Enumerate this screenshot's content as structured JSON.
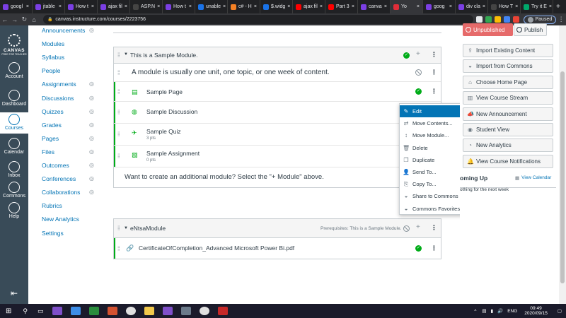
{
  "browser": {
    "tabs": [
      {
        "label": "googl",
        "color": "#7b3fe4"
      },
      {
        "label": "jtable",
        "color": "#7b3fe4"
      },
      {
        "label": "How t",
        "color": "#7b3fe4"
      },
      {
        "label": "ajax fil",
        "color": "#7b3fe4"
      },
      {
        "label": "ASP.N",
        "color": "#444444"
      },
      {
        "label": "How t",
        "color": "#7b3fe4"
      },
      {
        "label": "unable",
        "color": "#1a73e8"
      },
      {
        "label": "c# - H",
        "color": "#f48024"
      },
      {
        "label": "$.widg",
        "color": "#1a73e8"
      },
      {
        "label": "ajax fil",
        "color": "#ff0000"
      },
      {
        "label": "Part 3",
        "color": "#ff0000"
      },
      {
        "label": "canva",
        "color": "#7b3fe4"
      },
      {
        "label": "Yo",
        "color": "#e12d39",
        "active": true
      },
      {
        "label": "goog",
        "color": "#7b3fe4"
      },
      {
        "label": "div cla",
        "color": "#7b3fe4"
      },
      {
        "label": "How T",
        "color": "#444444"
      },
      {
        "label": "Try it E",
        "color": "#00a86b"
      }
    ],
    "url": "canvas.instructure.com/courses/2223756",
    "profile_status": "Paused"
  },
  "global_nav": {
    "logo": "CANVAS",
    "logo_sub": "FREE FOR TEACHER",
    "items": [
      {
        "label": "Account",
        "icon": "account-icon"
      },
      {
        "label": "Dashboard",
        "icon": "dashboard-icon"
      },
      {
        "label": "Courses",
        "icon": "courses-icon",
        "active": true
      },
      {
        "label": "Calendar",
        "icon": "calendar-icon"
      },
      {
        "label": "Inbox",
        "icon": "inbox-icon"
      },
      {
        "label": "Commons",
        "icon": "commons-icon"
      },
      {
        "label": "Help",
        "icon": "help-icon"
      }
    ]
  },
  "course_nav": {
    "items": [
      {
        "label": "Announcements",
        "hidden": true
      },
      {
        "label": "Modules",
        "hidden": false
      },
      {
        "label": "Syllabus",
        "hidden": false
      },
      {
        "label": "People",
        "hidden": false
      },
      {
        "label": "Assignments",
        "hidden": true
      },
      {
        "label": "Discussions",
        "hidden": true
      },
      {
        "label": "Quizzes",
        "hidden": true
      },
      {
        "label": "Grades",
        "hidden": true
      },
      {
        "label": "Pages",
        "hidden": true
      },
      {
        "label": "Files",
        "hidden": true
      },
      {
        "label": "Outcomes",
        "hidden": true
      },
      {
        "label": "Conferences",
        "hidden": true
      },
      {
        "label": "Collaborations",
        "hidden": true
      },
      {
        "label": "Rubrics",
        "hidden": false
      },
      {
        "label": "New Analytics",
        "hidden": false
      },
      {
        "label": "Settings",
        "hidden": false
      }
    ]
  },
  "modules": [
    {
      "title": "This is a Sample Module.",
      "description": "A module is usually one unit, one topic, or one week of content.",
      "items": [
        {
          "title": "Sample Page",
          "sub": "",
          "icon": "page-icon"
        },
        {
          "title": "Sample Discussion",
          "sub": "",
          "icon": "discussion-icon"
        },
        {
          "title": "Sample Quiz",
          "sub": "3 pts",
          "icon": "quiz-icon"
        },
        {
          "title": "Sample Assignment",
          "sub": "0 pts",
          "icon": "assignment-icon"
        }
      ],
      "footer": "Want to create an additional module? Select the \"+ Module\" above."
    },
    {
      "title": "eNtsaModule",
      "prerequisites": "Prerequisites: This is a Sample Module.",
      "items": [
        {
          "title": "CertificateOfCompletion_Advanced Microsoft Power Bi.pdf",
          "icon": "attachment-icon"
        }
      ]
    }
  ],
  "context_menu": {
    "items": [
      {
        "label": "Edit",
        "icon": "pencil-icon",
        "active": true
      },
      {
        "label": "Move Contents...",
        "icon": "move-contents-icon"
      },
      {
        "label": "Move Module...",
        "icon": "move-icon"
      },
      {
        "label": "Delete",
        "icon": "trash-icon"
      },
      {
        "label": "Duplicate",
        "icon": "duplicate-icon"
      },
      {
        "label": "Send To...",
        "icon": "user-icon"
      },
      {
        "label": "Copy To...",
        "icon": "copy-icon"
      },
      {
        "label": "Share to Commons",
        "icon": "commons-icon"
      },
      {
        "label": "Commons Favorites",
        "icon": "commons-icon"
      }
    ]
  },
  "right_sidebar": {
    "unpublished": "Unpublished",
    "publish": "Publish",
    "buttons": [
      {
        "label": "Import Existing Content",
        "icon": "import-icon"
      },
      {
        "label": "Import from Commons",
        "icon": "commons-icon"
      },
      {
        "label": "Choose Home Page",
        "icon": "home-icon"
      },
      {
        "label": "View Course Stream",
        "icon": "stream-icon"
      },
      {
        "label": "New Announcement",
        "icon": "announcement-icon"
      },
      {
        "label": "Student View",
        "icon": "student-view-icon"
      },
      {
        "label": "New Analytics",
        "icon": "analytics-icon"
      },
      {
        "label": "View Course Notifications",
        "icon": "bell-icon"
      }
    ],
    "coming_up": "oming Up",
    "view_calendar": "View Calendar",
    "nothing": "othing for the next week"
  },
  "taskbar": {
    "language": "ENG",
    "time": "09:49",
    "date": "2020/09/15"
  },
  "colors": {
    "canvas_nav": "#394b58",
    "link": "#0374b5",
    "published": "#00ac18",
    "unpublished": "#e0061f"
  }
}
